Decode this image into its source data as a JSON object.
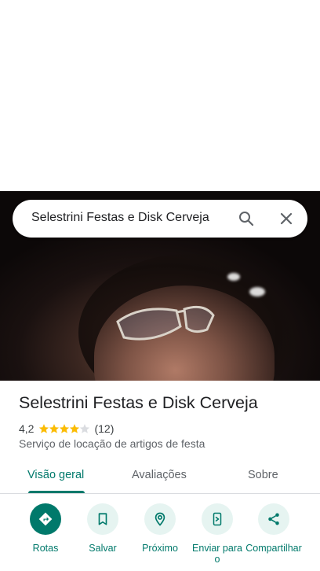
{
  "search": {
    "query": "Selestrini Festas e Disk Cerveja"
  },
  "place": {
    "name": "Selestrini Festas e Disk Cerveja",
    "rating": "4,2",
    "rating_stars": 4.2,
    "review_count": "(12)",
    "category": "Serviço de locação de artigos de festa"
  },
  "tabs": [
    {
      "label": "Visão geral",
      "active": true
    },
    {
      "label": "Avaliações",
      "active": false
    },
    {
      "label": "Sobre",
      "active": false
    }
  ],
  "actions": [
    {
      "label": "Rotas",
      "icon": "directions-icon"
    },
    {
      "label": "Salvar",
      "icon": "bookmark-icon"
    },
    {
      "label": "Próximo",
      "icon": "nearby-icon"
    },
    {
      "label": "Enviar para o",
      "icon": "send-to-phone-icon"
    },
    {
      "label": "Compartilhar",
      "icon": "share-icon"
    }
  ],
  "colors": {
    "accent": "#00796b",
    "accent_light": "#e6f4f1",
    "star": "#fbbc04",
    "text_primary": "#202124",
    "text_secondary": "#5f6368"
  }
}
